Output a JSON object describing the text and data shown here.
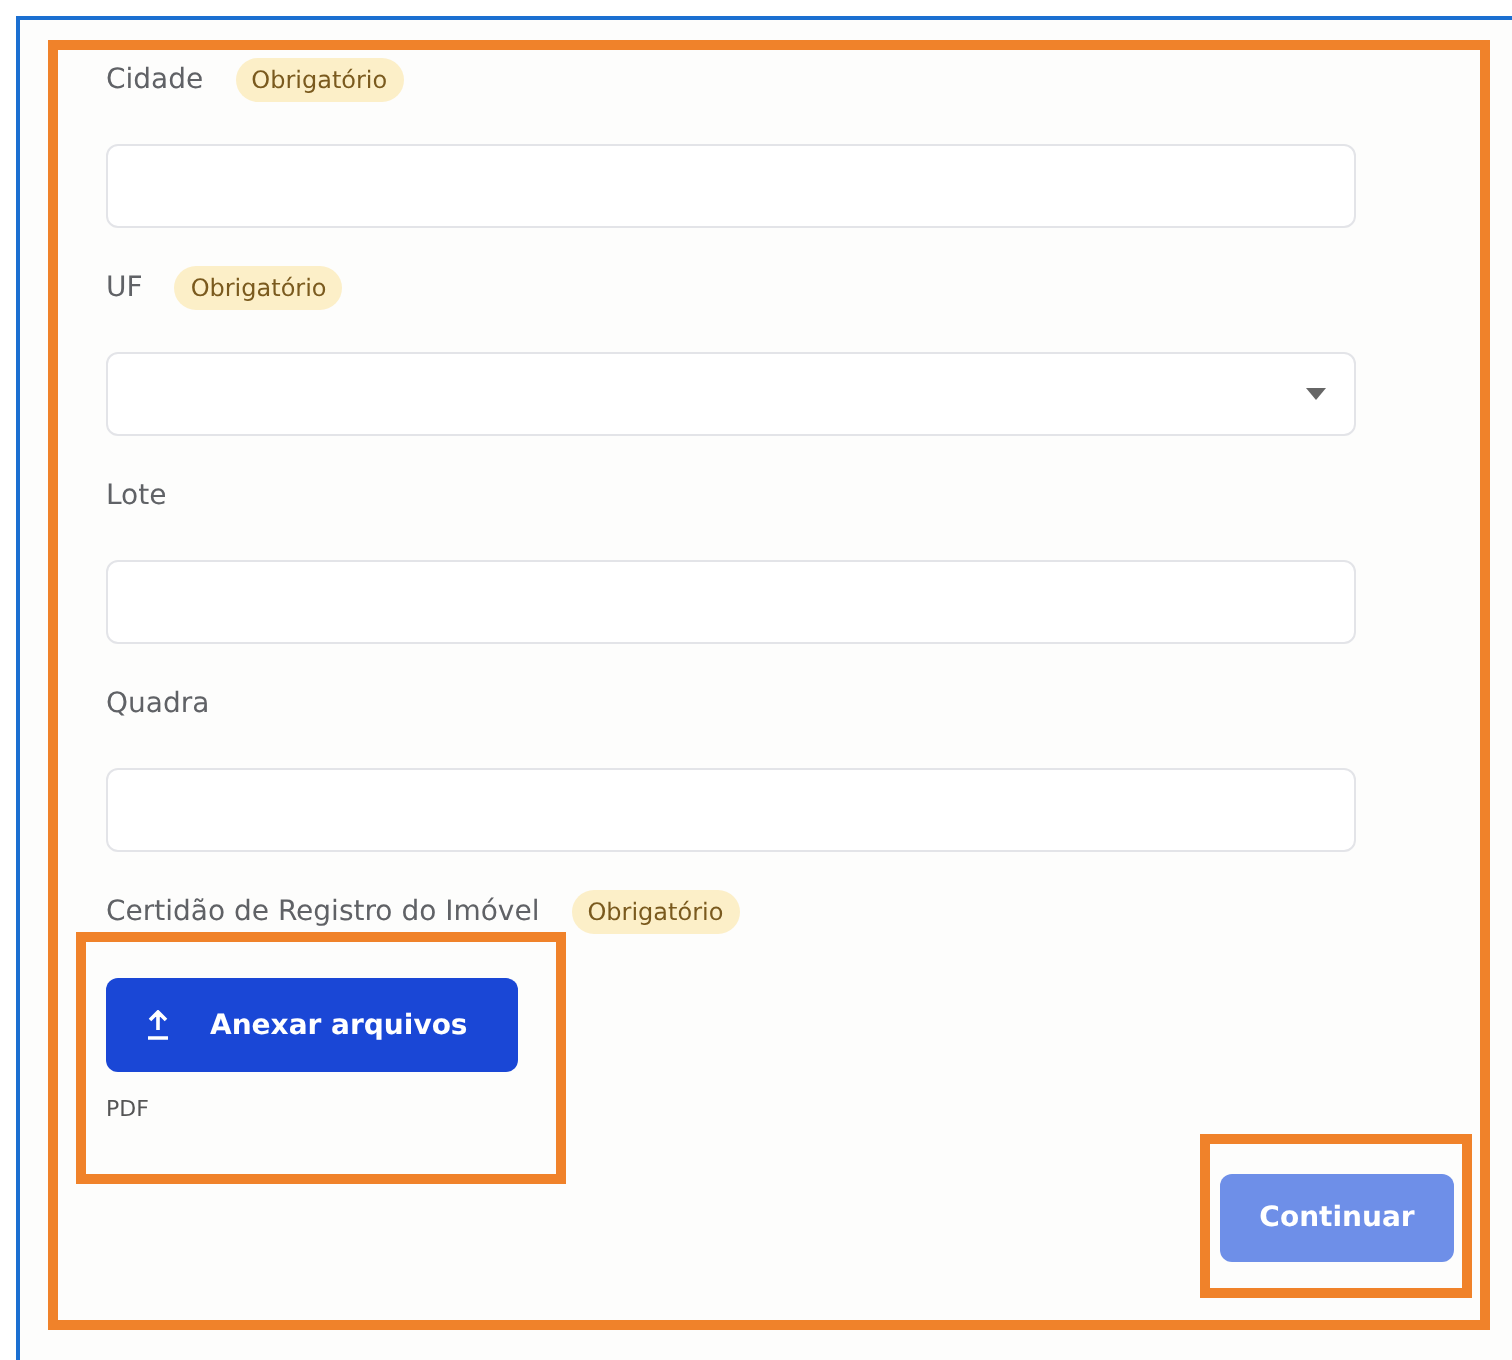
{
  "fields": [
    {
      "kind": "text",
      "label": "Cidade",
      "badge": "Obrigatório"
    },
    {
      "kind": "select",
      "label": "UF",
      "badge": "Obrigatório"
    },
    {
      "kind": "text",
      "label": "Lote"
    },
    {
      "kind": "text",
      "label": "Quadra"
    }
  ],
  "upload": {
    "label": "Certidão de Registro do Imóvel",
    "badge": "Obrigatório",
    "button": "Anexar arquivos",
    "hint": "PDF"
  },
  "continue_button": {
    "label": "Continuar",
    "disabled": true
  }
}
